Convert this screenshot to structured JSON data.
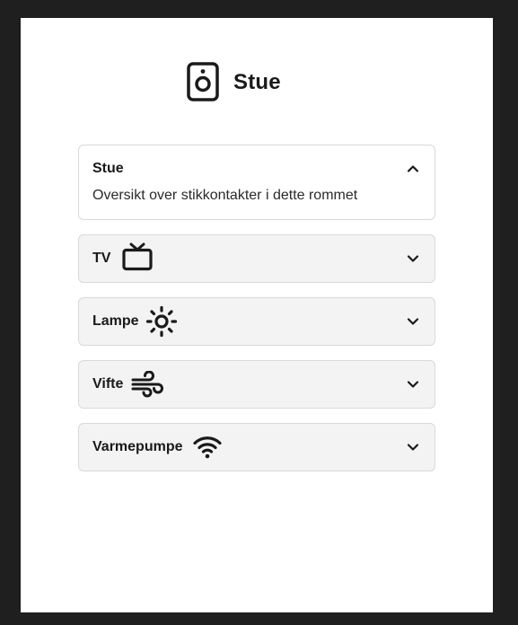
{
  "room": {
    "title": "Stue",
    "icon": "speaker-icon"
  },
  "sections": [
    {
      "title": "Stue",
      "description": "Oversikt over stikkontakter i dette rommet",
      "expanded": true
    },
    {
      "title": "TV",
      "icon": "tv-icon",
      "expanded": false
    },
    {
      "title": "Lampe",
      "icon": "sun-icon",
      "expanded": false
    },
    {
      "title": "Vifte",
      "icon": "wind-icon",
      "expanded": false
    },
    {
      "title": "Varmepumpe",
      "icon": "wifi-icon",
      "expanded": false
    }
  ],
  "colors": {
    "background": "#1f1f1f",
    "card": "#ffffff",
    "panel_closed": "#f3f3f3",
    "border": "#d9d9d9",
    "text": "#1a1a1a"
  }
}
